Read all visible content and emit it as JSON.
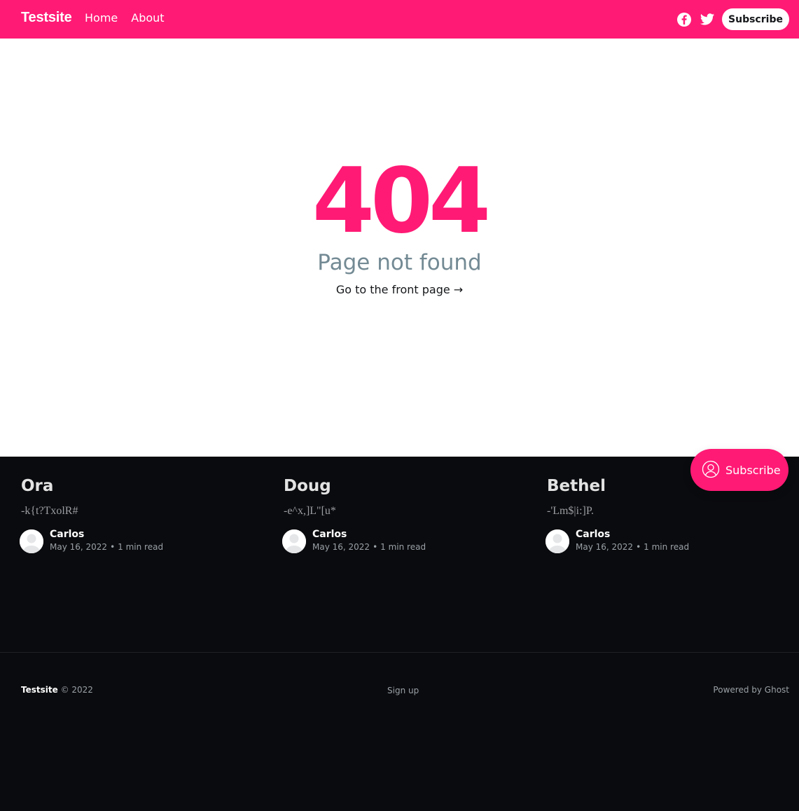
{
  "header": {
    "logo": "Testsite",
    "nav": [
      "Home",
      "About"
    ],
    "social": [
      {
        "icon": "facebook-icon"
      },
      {
        "icon": "twitter-icon"
      }
    ],
    "subscribe_label": "Subscribe"
  },
  "error": {
    "code": "404",
    "message": "Page not found",
    "link_text": "Go to the front page →"
  },
  "cards": [
    {
      "title": "Ora",
      "excerpt": "-k{t?TxolR#",
      "author": "Carlos",
      "date": "May 16, 2022",
      "read_time": "1 min read"
    },
    {
      "title": "Doug",
      "excerpt": "-e^x,]L\"[u*",
      "author": "Carlos",
      "date": "May 16, 2022",
      "read_time": "1 min read"
    },
    {
      "title": "Bethel",
      "excerpt": "-'Lm$|i:]P.",
      "author": "Carlos",
      "date": "May 16, 2022",
      "read_time": "1 min read"
    }
  ],
  "footer": {
    "site_name": "Testsite",
    "copyright": "© 2022",
    "signup": "Sign up",
    "powered": "Powered by Ghost"
  },
  "portal": {
    "label": "Subscribe"
  },
  "colors": {
    "accent": "#ff1a75",
    "dark_bg": "#0a0b0e",
    "muted": "#738a94"
  }
}
